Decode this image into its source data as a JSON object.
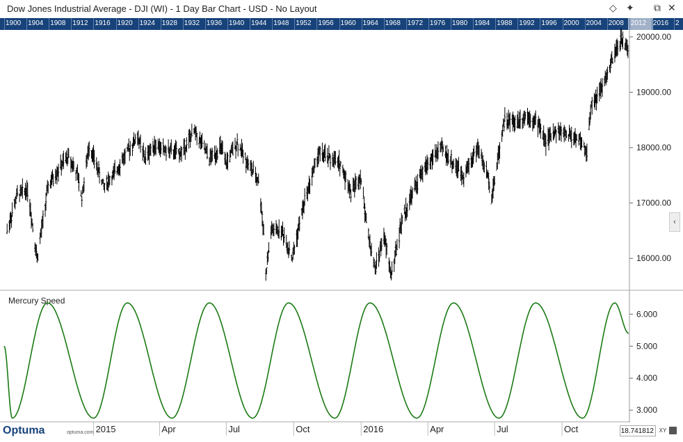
{
  "window": {
    "title": "Dow Jones Industrial Average - DJI (WI) - 1 Day Bar Chart - USD - No Layout",
    "pin_label": "◇",
    "tack_label": "✦",
    "restore_label": "⧉",
    "close_label": "✕"
  },
  "year_bar": [
    "1900",
    "1904",
    "1908",
    "1912",
    "1916",
    "1920",
    "1924",
    "1928",
    "1932",
    "1936",
    "1940",
    "1944",
    "1948",
    "1952",
    "1956",
    "1960",
    "1964",
    "1968",
    "1972",
    "1976",
    "1980",
    "1984",
    "1988",
    "1992",
    "1996",
    "2000",
    "2004",
    "2008",
    "2012",
    "2016",
    "2"
  ],
  "footer": {
    "logo": "Optuma",
    "site": "optuma.com",
    "coordinate": "18.741812",
    "xy_label": "XY",
    "side_tab": "‹"
  },
  "colors": {
    "navy": "#17427a",
    "green_line": "#1a7a12",
    "bars": "#000000"
  },
  "chart_data": [
    {
      "type": "bar",
      "subtype": "ohlc-daily",
      "title": "Dow Jones Industrial Average - DJI (WI) - 1 Day Bar Chart - USD - No Layout",
      "x_ticks": [
        "2015",
        "Apr",
        "Jul",
        "Oct",
        "2016",
        "Apr",
        "Jul",
        "Oct"
      ],
      "y_ticks": [
        "16000.00",
        "17000.00",
        "18000.00",
        "19000.00",
        "20000.00"
      ],
      "ylim": [
        15450,
        20100
      ],
      "x_range": [
        "2014-09",
        "2016-12"
      ],
      "points": [
        [
          "2014-09-05",
          16500
        ],
        [
          "2014-09-19",
          17150
        ],
        [
          "2014-10-03",
          17250
        ],
        [
          "2014-10-16",
          16000
        ],
        [
          "2014-10-31",
          17300
        ],
        [
          "2014-11-14",
          17600
        ],
        [
          "2014-11-28",
          17850
        ],
        [
          "2014-12-10",
          17500
        ],
        [
          "2014-12-16",
          17100
        ],
        [
          "2014-12-26",
          18050
        ],
        [
          "2015-01-15",
          17300
        ],
        [
          "2015-01-28",
          17500
        ],
        [
          "2015-02-10",
          17800
        ],
        [
          "2015-03-02",
          18200
        ],
        [
          "2015-03-12",
          17800
        ],
        [
          "2015-03-24",
          18050
        ],
        [
          "2015-04-10",
          17950
        ],
        [
          "2015-04-30",
          17900
        ],
        [
          "2015-05-19",
          18300
        ],
        [
          "2015-06-08",
          17800
        ],
        [
          "2015-06-24",
          18000
        ],
        [
          "2015-06-30",
          17700
        ],
        [
          "2015-07-16",
          18100
        ],
        [
          "2015-07-31",
          17700
        ],
        [
          "2015-08-14",
          17400
        ],
        [
          "2015-08-21",
          16500
        ],
        [
          "2015-08-24",
          15700
        ],
        [
          "2015-08-31",
          16500
        ],
        [
          "2015-09-15",
          16500
        ],
        [
          "2015-09-29",
          16000
        ],
        [
          "2015-10-15",
          17000
        ],
        [
          "2015-11-04",
          17900
        ],
        [
          "2015-11-20",
          17800
        ],
        [
          "2015-12-04",
          17700
        ],
        [
          "2015-12-18",
          17200
        ],
        [
          "2015-12-31",
          17500
        ],
        [
          "2016-01-11",
          16400
        ],
        [
          "2016-01-20",
          15800
        ],
        [
          "2016-02-01",
          16400
        ],
        [
          "2016-02-11",
          15700
        ],
        [
          "2016-02-26",
          16700
        ],
        [
          "2016-03-15",
          17300
        ],
        [
          "2016-03-31",
          17700
        ],
        [
          "2016-04-20",
          18000
        ],
        [
          "2016-05-06",
          17700
        ],
        [
          "2016-05-19",
          17500
        ],
        [
          "2016-06-08",
          18000
        ],
        [
          "2016-06-24",
          17400
        ],
        [
          "2016-06-27",
          17100
        ],
        [
          "2016-07-14",
          18500
        ],
        [
          "2016-07-29",
          18450
        ],
        [
          "2016-08-15",
          18600
        ],
        [
          "2016-08-31",
          18400
        ],
        [
          "2016-09-09",
          18100
        ],
        [
          "2016-09-22",
          18300
        ],
        [
          "2016-10-06",
          18250
        ],
        [
          "2016-10-25",
          18150
        ],
        [
          "2016-11-04",
          17900
        ],
        [
          "2016-11-10",
          18800
        ],
        [
          "2016-11-22",
          19000
        ],
        [
          "2016-12-07",
          19500
        ],
        [
          "2016-12-20",
          19950
        ],
        [
          "2016-12-30",
          19800
        ]
      ]
    },
    {
      "type": "line",
      "title": "Mercury Speed",
      "y_ticks": [
        "3.000",
        "4.000",
        "5.000",
        "6.000"
      ],
      "ylim": [
        2.7,
        6.55
      ],
      "series": [
        {
          "name": "Mercury Speed",
          "x_range": [
            "2014-09",
            "2016-12"
          ],
          "peaks": [
            "2014-10-30",
            "2015-02-16",
            "2015-06-08",
            "2015-09-24",
            "2016-01-13",
            "2016-05-06",
            "2016-08-26",
            "2016-12-12"
          ],
          "troughs": [
            "2014-09-12",
            "2015-01-01",
            "2015-04-18",
            "2015-08-06",
            "2015-11-26",
            "2016-03-17",
            "2016-07-07",
            "2016-10-29"
          ],
          "max": 6.35,
          "min": 2.75,
          "start_value": 5.0,
          "end_value": 5.4
        }
      ]
    }
  ]
}
